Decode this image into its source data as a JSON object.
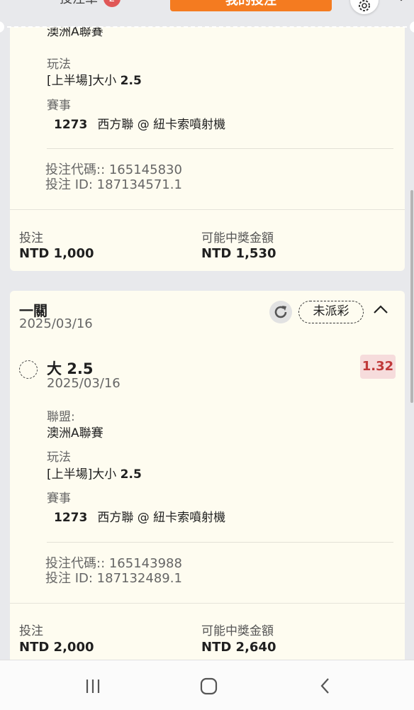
{
  "header": {
    "betslip_label": "投注單",
    "betslip_count": "2",
    "mybets_label": "我的投注"
  },
  "bet1": {
    "league_value": "澳洲A聯賽",
    "market_label": "玩法",
    "market_prefix": "[上半場]大小 ",
    "market_line": "2.5",
    "event_label": "賽事",
    "event_id": "1273",
    "event_name": "西方聯 @ 紐卡索噴射機",
    "bet_code": "投注代碼:: 165145830",
    "bet_id": "投注 ID: 187134571.1",
    "stake_label": "投注",
    "stake_value": "NTD 1,000",
    "payout_label": "可能中獎金額",
    "payout_value": "NTD 1,530"
  },
  "bet2": {
    "type_title": "一關",
    "date": "2025/03/16",
    "status": "未派彩",
    "selection": "大 2.5",
    "selection_date": "2025/03/16",
    "odds": "1.32",
    "league_label": "聯盟:",
    "league_value": "澳洲A聯賽",
    "market_label": "玩法",
    "market_prefix": "[上半場]大小 ",
    "market_line": "2.5",
    "event_label": "賽事",
    "event_id": "1273",
    "event_name": "西方聯 @ 紐卡索噴射機",
    "bet_code": "投注代碼:: 165143988",
    "bet_id": "投注 ID: 187132489.1",
    "stake_label": "投注",
    "stake_value": "NTD 2,000",
    "payout_label": "可能中獎金額",
    "payout_value": "NTD 2,640"
  },
  "navbar": {
    "icons": [
      "recent-apps-icon",
      "home-icon",
      "back-icon"
    ]
  },
  "colors": {
    "accent": "#f47b20",
    "card_bg": "#fefcf0",
    "odds_text": "#c03a3a",
    "odds_bg": "#f6dcdc"
  }
}
